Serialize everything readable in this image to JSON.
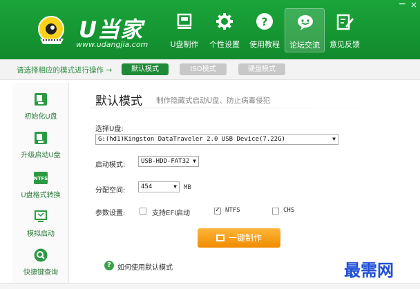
{
  "header": {
    "logo_title": "U当家",
    "logo_url": "www.udangjia.com",
    "nav": [
      {
        "label": "U盘制作",
        "icon": "usb-drive-icon"
      },
      {
        "label": "个性设置",
        "icon": "gear-icon"
      },
      {
        "label": "使用教程",
        "icon": "question-icon"
      },
      {
        "label": "论坛交流",
        "icon": "chat-bubble-icon"
      },
      {
        "label": "意见反馈",
        "icon": "edit-icon"
      }
    ],
    "min_symbol": "−",
    "close_symbol": "×"
  },
  "modebar": {
    "hint": "请选择相应的模式进行操作 →",
    "modes": [
      "默认模式",
      "ISO模式",
      "硬盘模式"
    ]
  },
  "sidebar": {
    "items": [
      {
        "label": "初始化U盘",
        "icon": "usb-init-icon"
      },
      {
        "label": "升级启动U盘",
        "icon": "usb-upgrade-icon"
      },
      {
        "label": "U盘格式转换",
        "icon": "ntfs-icon",
        "icon_text": "NTFS"
      },
      {
        "label": "模拟启动",
        "icon": "monitor-icon"
      },
      {
        "label": "快捷键查询",
        "icon": "search-icon"
      }
    ]
  },
  "main": {
    "title": "默认模式",
    "subtitle": "制作隐藏式启动U盘、防止病毒侵犯",
    "select_usb_label": "选择U盘:",
    "select_usb_value": "G:(hd1)Kingston DataTraveler 2.0 USB Device(7.22G)",
    "boot_mode_label": "启动模式:",
    "boot_mode_value": "USB-HDD-FAT32",
    "alloc_label": "分配空间:",
    "alloc_value": "454",
    "alloc_unit": "MB",
    "params_label": "参数设置:",
    "options": [
      {
        "label": "支持EFI启动",
        "checked": false
      },
      {
        "label": "NTFS",
        "checked": true
      },
      {
        "label": "CHS",
        "checked": false
      }
    ],
    "make_button": "一键制作",
    "help_text": "如何使用默认模式"
  },
  "watermark": "最需网"
}
